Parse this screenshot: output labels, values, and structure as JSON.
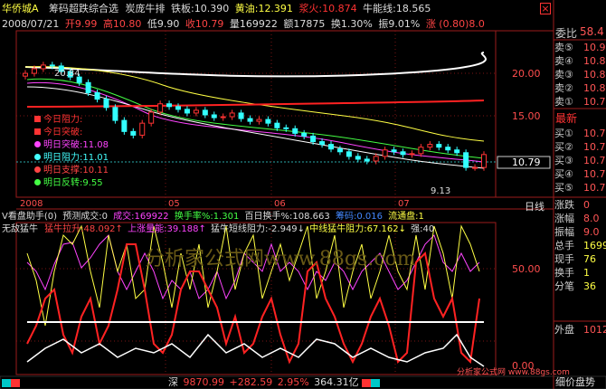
{
  "header": {
    "stock_name": "华侨城A",
    "formula_name": "筹码超跌综合选",
    "tornado": "炭庞牛排",
    "iron_plate": "铁板:10.390",
    "yellow_oil": "黄油:12.391",
    "spice_fire": "浆火:10.874",
    "bull_energy": "牛能线:18.565",
    "close_x": "×"
  },
  "quote": {
    "date": "2008/07/21",
    "open": "开9.99",
    "high": "高10.80",
    "low": "低9.90",
    "close": "收10.79",
    "volume": "量169922",
    "amount": "额17875",
    "turnover": "换1.30%",
    "amplitude": "振9.01%",
    "change": "涨 (0.80)8.0"
  },
  "chart_data": {
    "type": "line",
    "x_labels": [
      "2008",
      "05",
      "06",
      "07"
    ],
    "y_ticks": [
      20.0,
      15.0,
      10.0
    ],
    "price_label": "10.79",
    "high_annotation": "20.84",
    "low_annotation": "9.13",
    "close_series": [
      19.6,
      20.1,
      20.5,
      20.4,
      19.8,
      19.2,
      18.6,
      17.5,
      16.8,
      15.9,
      14.5,
      13.3,
      12.9,
      14.2,
      15.4,
      16.3,
      16.0,
      15.7,
      15.3,
      15.6,
      15.1,
      14.8,
      14.9,
      15.3,
      14.7,
      14.4,
      14.6,
      14.2,
      13.7,
      13.6,
      13.1,
      12.8,
      12.2,
      11.9,
      11.4,
      11.1,
      10.6,
      10.3,
      10.1,
      10.6,
      11.3,
      11.1,
      10.8,
      10.9,
      11.6,
      11.9,
      11.6,
      11.3,
      11.0,
      9.4,
      9.4,
      10.8
    ],
    "series": [
      {
        "name": "white_long",
        "values": [
          22.0,
          21.9,
          21.8,
          21.7,
          21.6,
          21.5,
          21.4,
          21.3,
          21.2,
          21.1,
          21.0,
          20.8,
          20.6,
          20.4,
          20.2,
          20.0,
          19.8,
          19.6,
          19.4,
          19.2,
          19.0,
          18.8
        ]
      },
      {
        "name": "red_flat",
        "values": [
          15.9,
          15.9,
          16.0,
          16.1,
          16.2,
          16.2,
          16.3,
          16.3,
          16.4,
          16.4,
          16.5,
          16.5,
          16.6,
          16.6,
          16.7,
          16.7
        ]
      }
    ],
    "legend_items": [
      {
        "label": "今日阻力:",
        "color": "#ff3333"
      },
      {
        "label": "今日突破:",
        "color": "#ff3333"
      },
      {
        "label": "明日突破:11.08",
        "color": "#ff44ff"
      },
      {
        "label": "明日阻力:11.01",
        "color": "#44ffff"
      },
      {
        "label": "明日支撑:10.11",
        "color": "#ff4444"
      },
      {
        "label": "明日反转:9.55",
        "color": "#44ff44"
      }
    ]
  },
  "volume_strip": {
    "title": "V看盘助手(0)",
    "fields": [
      {
        "text": "预测成交:0",
        "color": "#dddddd"
      },
      {
        "text": "成交:169922",
        "color": "#ff44ff"
      },
      {
        "text": "换手率%:1.301",
        "color": "#44ff44"
      },
      {
        "text": "百日换手%:108.663",
        "color": "#dddddd"
      },
      {
        "text": "筹码:0.016",
        "color": "#4488ff"
      },
      {
        "text": "流通盘:1",
        "color": "#ffff44"
      }
    ]
  },
  "indicator": {
    "title": "无敌猛牛",
    "fields": [
      {
        "text": "猛牛拉升:48.092↑",
        "color": "#ff4444"
      },
      {
        "text": "上涨量能:39.188↑",
        "color": "#ff44ff"
      },
      {
        "text": "猛牛短线阻力:-2.949↓",
        "color": "#dddddd"
      },
      {
        "text": "中线猛牛阻力:67.162↓",
        "color": "#ffff44"
      },
      {
        "text": "强:40",
        "color": "#dddddd"
      }
    ],
    "y_ticks": [
      50.0,
      0.0
    ]
  },
  "watermark": "分析家公式网www.88gs.com",
  "side_panel": {
    "top_label": "委比",
    "top_value": "58.4",
    "rows": [
      {
        "k": "卖⑤",
        "v": "10.9"
      },
      {
        "k": "卖④",
        "v": "10.8"
      },
      {
        "k": "卖③",
        "v": "10.8"
      },
      {
        "k": "卖②",
        "v": "10.8"
      },
      {
        "k": "卖①",
        "v": "10.7"
      }
    ],
    "latest": "最新",
    "rows2": [
      {
        "k": "买①",
        "v": "10.7"
      },
      {
        "k": "买②",
        "v": "10.7"
      },
      {
        "k": "买③",
        "v": "10.7"
      },
      {
        "k": "买④",
        "v": "10.7"
      },
      {
        "k": "买⑤",
        "v": "10.7"
      }
    ],
    "day_line": "日线",
    "stats": [
      {
        "k": "涨跌",
        "v": "0"
      },
      {
        "k": "涨幅",
        "v": "8.0"
      },
      {
        "k": "振幅",
        "v": "9.0"
      },
      {
        "k": "总手",
        "v": "1699"
      },
      {
        "k": "现手",
        "v": "76"
      },
      {
        "k": "换手",
        "v": "1"
      },
      {
        "k": "分笔",
        "v": "36"
      }
    ],
    "outer": "外盘",
    "outer_value": "1012",
    "bottom": "细价盘势"
  },
  "statusbar": {
    "index_name": "深",
    "index_value": "9870.99",
    "index_change": "+282.59",
    "index_pct": "2.95%",
    "index_amount": "364.31亿",
    "watermark_small": "分析家公式网 www.88gs.com"
  }
}
